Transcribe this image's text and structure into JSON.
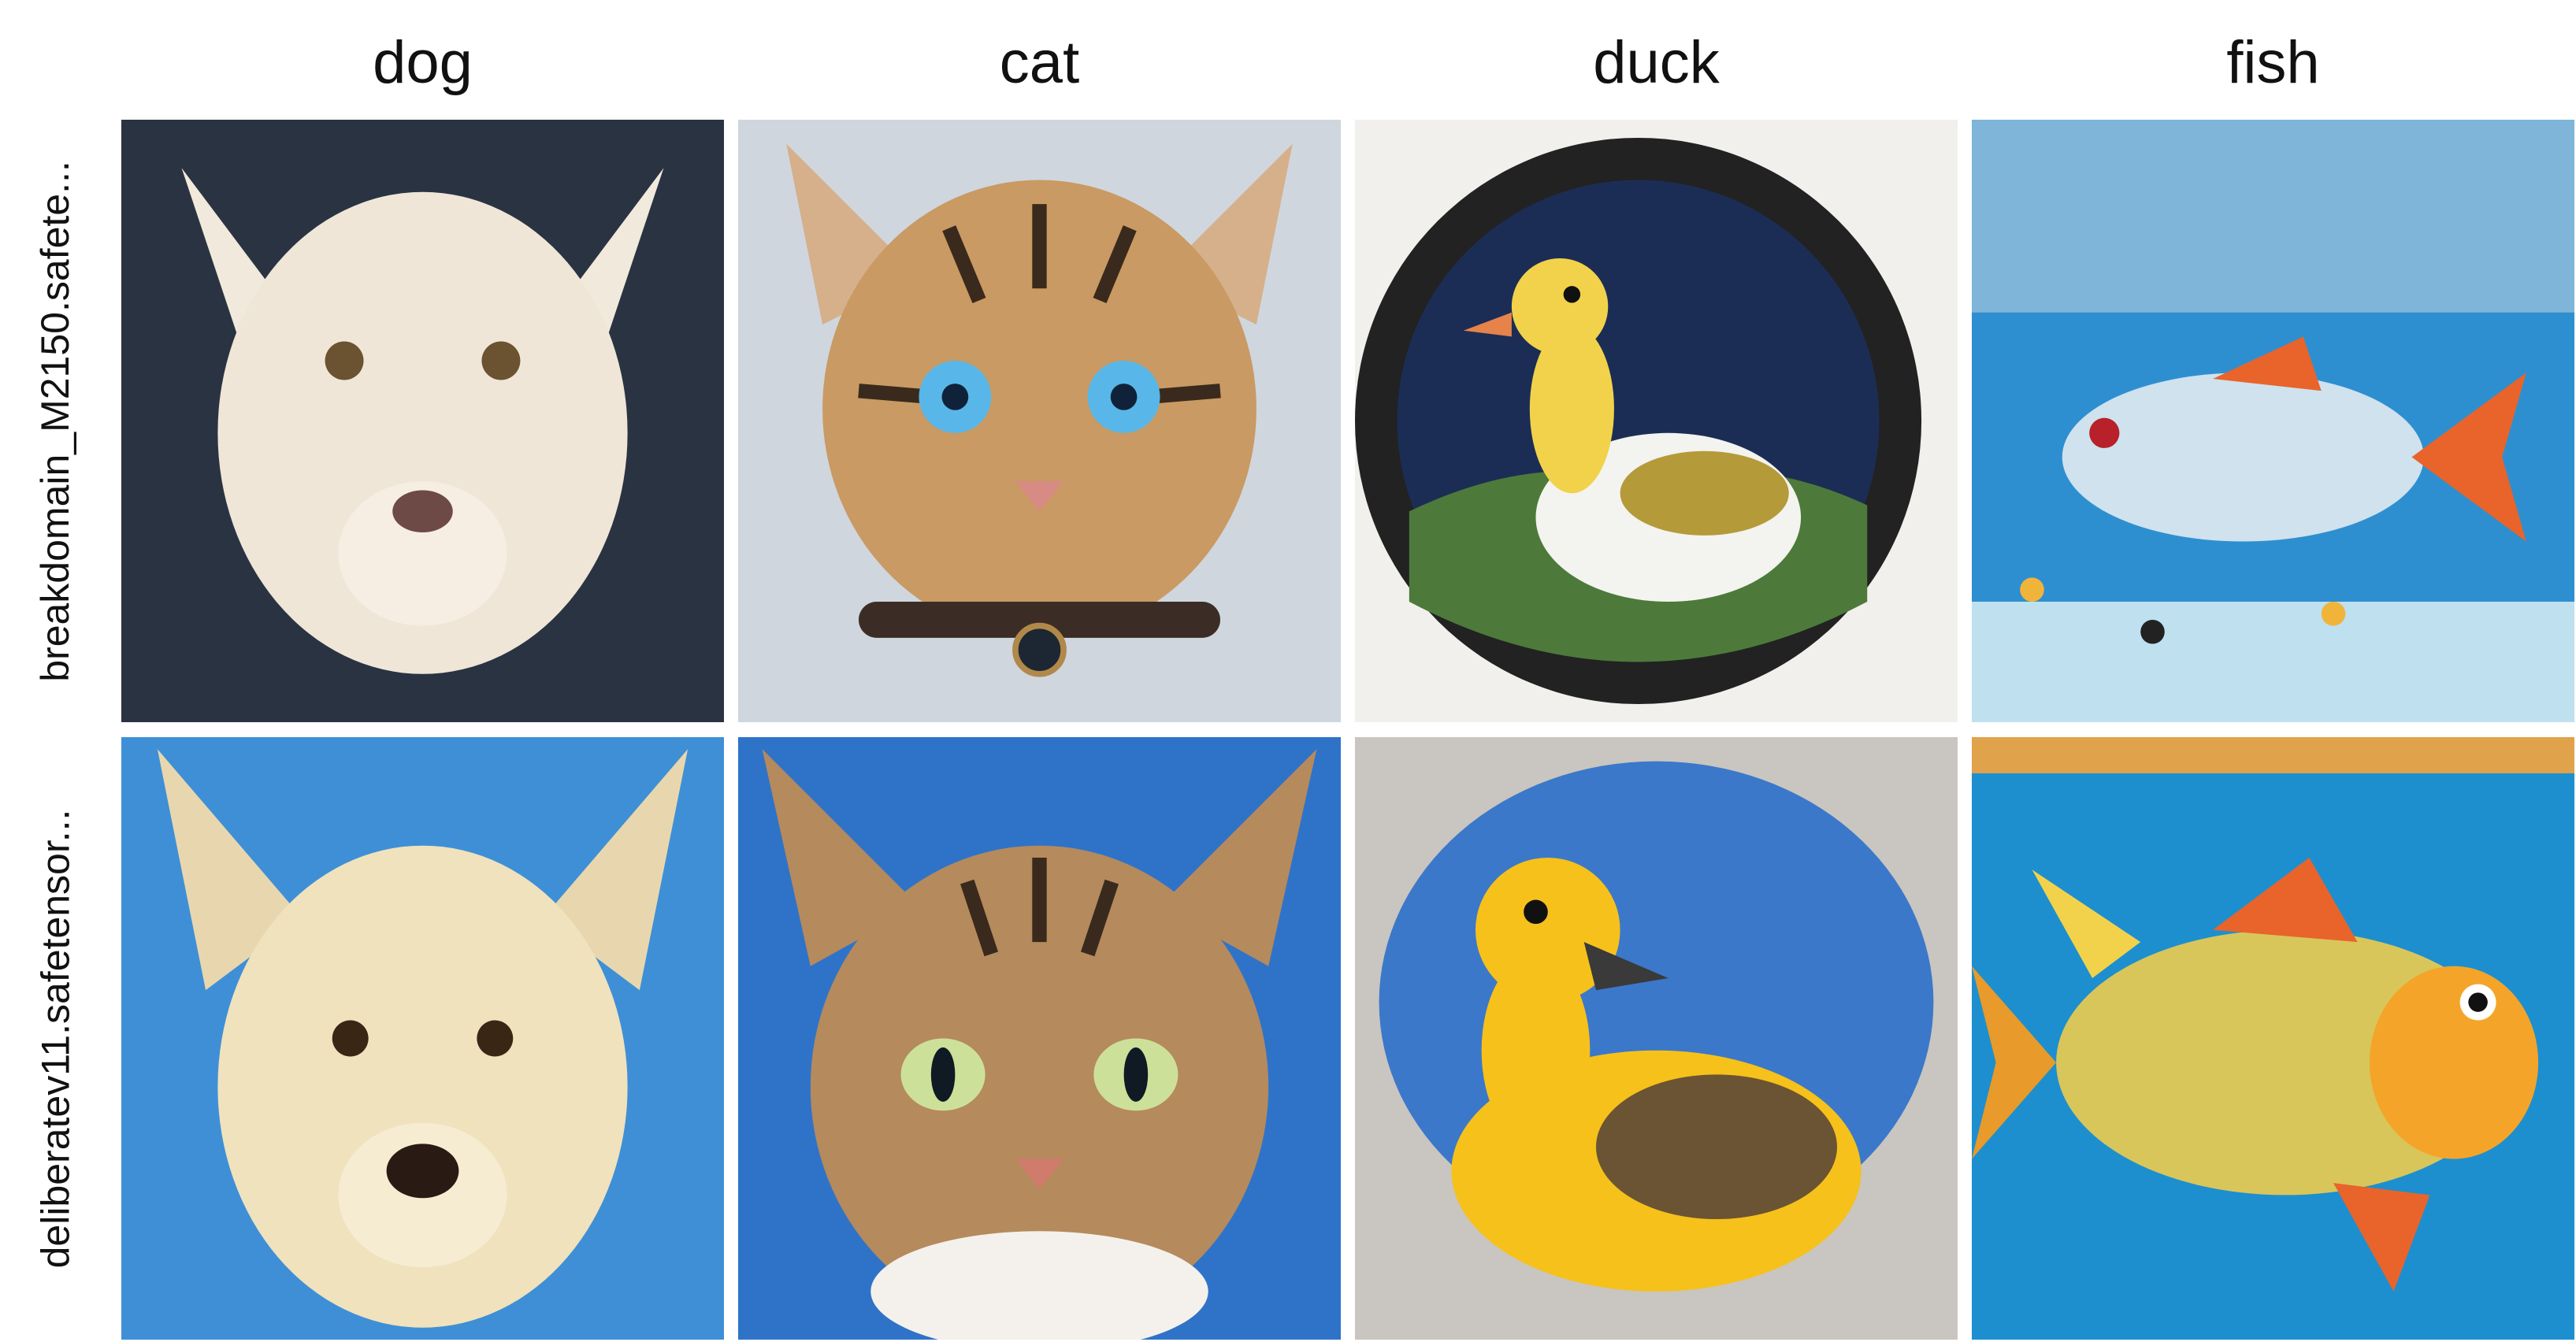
{
  "columns": [
    "dog",
    "cat",
    "duck",
    "fish"
  ],
  "rows": [
    {
      "label": "breakdomain_M2150.safete...",
      "images": [
        {
          "subject": "dog",
          "description": "white fluffy dog portrait, dark blue-gray background",
          "bg": "#2a3342",
          "main": "#efe6d8"
        },
        {
          "subject": "cat",
          "description": "tabby cat with blue eyes and studded collar",
          "bg": "#cfd6de",
          "main": "#c99a63"
        },
        {
          "subject": "duck",
          "description": "yellow-white duck inside a round black porthole frame with night sky",
          "bg": "#f2f0ec",
          "main": "#f1d24a"
        },
        {
          "subject": "fish",
          "description": "silver-orange fish underwater with small tropical fish",
          "bg": "#2e8fd0",
          "main": "#cfe2ee"
        }
      ]
    },
    {
      "label": "deliberatev11.safetensor...",
      "images": [
        {
          "subject": "dog",
          "description": "cream dog with large ears against blue sky",
          "bg": "#3f8fd6",
          "main": "#efe2bd"
        },
        {
          "subject": "cat",
          "description": "tabby cat with green eyes against blue background",
          "bg": "#2f73c9",
          "main": "#b58a5c"
        },
        {
          "subject": "duck",
          "description": "yellow duckling sitting in front of blue sphere",
          "bg": "#c9c5c0",
          "main": "#f6c11a"
        },
        {
          "subject": "fish",
          "description": "golden-green fish with orange fins underwater",
          "bg": "#1d8fcf",
          "main": "#d8c65a"
        }
      ]
    }
  ]
}
